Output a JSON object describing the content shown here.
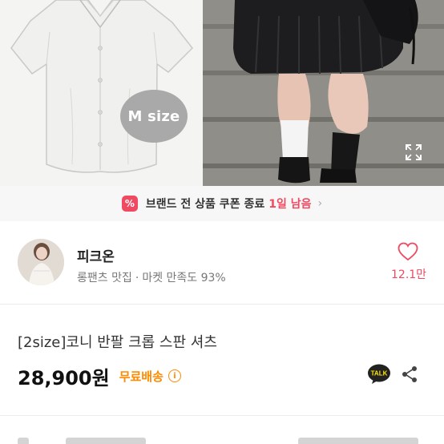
{
  "hero": {
    "left_image": "cropped gray short-sleeve shirt product photo",
    "right_image": "model wearing black pleated skirt with white socks on steps",
    "size_badge": "M size",
    "expand_icon": "expand-icon"
  },
  "coupon": {
    "icon": "%",
    "text": "브랜드 전 상품 쿠폰 종료",
    "highlight": "1일 남음",
    "chevron": "›",
    "color": "#ef4a62"
  },
  "seller": {
    "name": "피크온",
    "tagline": "롱팬츠 맛집",
    "separator": "·",
    "satisfaction": "마켓 만족도 93%",
    "likes": "12.1만"
  },
  "product": {
    "title": "[2size]코니 반팔 크롭 스판 셔츠",
    "price": "28,900원",
    "shipping": "무료배송",
    "info_icon": "i",
    "shipping_color": "#ff8a00"
  },
  "actions": {
    "talk_label": "TALK"
  }
}
